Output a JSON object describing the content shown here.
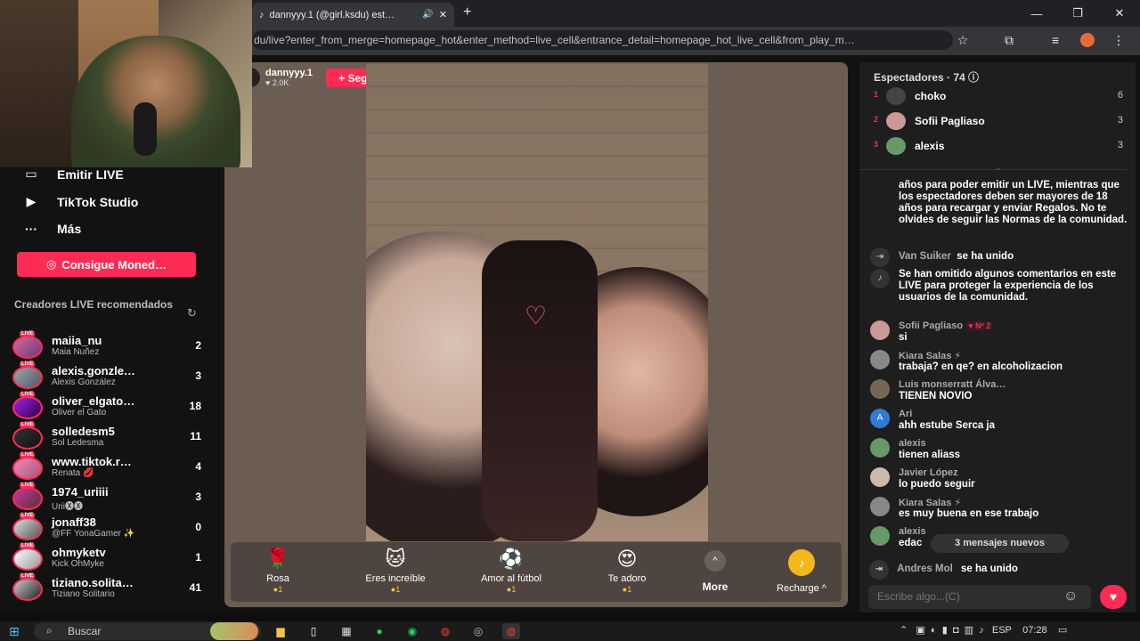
{
  "browser": {
    "tab_title": "dannyyy.1 (@girl.ksdu) est…",
    "new_tab": "+",
    "url": "du/live?enter_from_merge=homepage_hot&enter_method=live_cell&entrance_detail=homepage_hot_live_cell&from_play_m…",
    "window": {
      "minimize": "—",
      "restore": "❐",
      "close": "✕"
    }
  },
  "sidebar": {
    "nav": [
      {
        "label": "Emitir LIVE",
        "icon": "camera-icon"
      },
      {
        "label": "TikTok Studio",
        "icon": "studio-icon"
      },
      {
        "label": "Más",
        "icon": "more-icon"
      }
    ],
    "coins_button": "Consigue Moned…",
    "recommended_title": "Creadores LIVE recomendados",
    "creators": [
      {
        "name": "maiia_nu",
        "sub": "Maia Nuñez",
        "count": "2"
      },
      {
        "name": "alexis.gonzle…",
        "sub": "Alexis González",
        "count": "3"
      },
      {
        "name": "oliver_elgato…",
        "sub": "Oliver el Gato",
        "count": "18"
      },
      {
        "name": "solledesm5",
        "sub": "Sol Ledesma",
        "count": "11"
      },
      {
        "name": "www.tiktok.r…",
        "sub": "Renata 💋",
        "count": "4"
      },
      {
        "name": "1974_uriiii",
        "sub": "Urii🅧🅧",
        "count": "3"
      },
      {
        "name": "jonaff38",
        "sub": "@FF YonaGamer ✨",
        "count": "0"
      },
      {
        "name": "ohmyketv",
        "sub": "Kick OhMyke",
        "count": "1"
      },
      {
        "name": "tiziano.solita…",
        "sub": "Tiziano Solitario",
        "count": "41"
      }
    ],
    "live_badge": "LIVE"
  },
  "stream": {
    "host_name": "dannyyy.1",
    "host_likes": "♥ 2.0K",
    "follow_label": "+ Seguir"
  },
  "gifts": [
    {
      "name": "Rosa",
      "price": "●1",
      "icon": "🌹"
    },
    {
      "name": "Eres increíble",
      "price": "●1",
      "icon": "🐱"
    },
    {
      "name": "Amor al fútbol",
      "price": "●1",
      "icon": "⚽"
    },
    {
      "name": "Te adoro",
      "price": "●1",
      "icon": "😍"
    }
  ],
  "more_label": "More",
  "recharge_label": "Recharge ^",
  "chat": {
    "viewers_title": "Espectadores · 74 ⓘ",
    "top_viewers": [
      {
        "rank": "1",
        "name": "choko",
        "score": "6"
      },
      {
        "rank": "2",
        "name": "Sofii Pagliaso",
        "score": "3"
      },
      {
        "rank": "3",
        "name": "alexis",
        "score": "3"
      }
    ],
    "rules_text": "años para poder emitir un LIVE, mientras que los espectadores deben ser mayores de 18 años para recargar y enviar Regalos. No te olvides de seguir las Normas de la comunidad.",
    "join_1": {
      "name": "Van Suiker",
      "action": "se ha unido"
    },
    "omitted_text": "Se han omitido algunos comentarios en este LIVE para proteger la experiencia de los usuarios de la comunidad.",
    "messages": [
      {
        "name": "Sofii Pagliaso",
        "badge": "♥ Nº 2",
        "text": "si",
        "avatar": ""
      },
      {
        "name": "Kiara Salas ⚡",
        "badge": "",
        "text": "trabaja? en qe? en alcoholizacion",
        "avatar": ""
      },
      {
        "name": "Luis monserratt Álva…",
        "badge": "",
        "text": "TIENEN NOVIO",
        "avatar": ""
      },
      {
        "name": "Ari",
        "badge": "",
        "text": "ahh estube Serca ja",
        "avatar": "A"
      },
      {
        "name": "alexis",
        "badge": "",
        "text": "tienen aliass",
        "avatar": ""
      },
      {
        "name": "Javier López",
        "badge": "",
        "text": "lo puedo seguir",
        "avatar": ""
      },
      {
        "name": "Kiara Salas ⚡",
        "badge": "",
        "text": "es muy buena en ese trabajo",
        "avatar": ""
      },
      {
        "name": "alexis",
        "badge": "",
        "text": "edac",
        "avatar": ""
      }
    ],
    "new_messages": "3 mensajes nuevos",
    "join_2": {
      "name": "Andres Mol",
      "action": "se ha unido"
    },
    "input_placeholder": "Escribe algo...(C)"
  },
  "taskbar": {
    "search_label": "Buscar",
    "lang": "ESP",
    "time": "07:28"
  }
}
